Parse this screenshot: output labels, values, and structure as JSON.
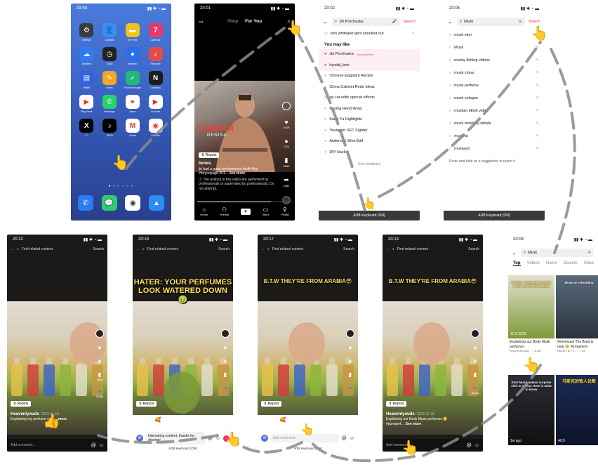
{
  "home": {
    "time": "19:58",
    "apps": [
      {
        "name": "Settings",
        "icon": "gear-icon",
        "color": "#3b3b3b",
        "glyph": "⚙"
      },
      {
        "name": "Contacts",
        "icon": "person-icon",
        "color": "#3a8ef2",
        "glyph": "👤"
      },
      {
        "name": "My Files",
        "icon": "folder-icon",
        "color": "#f2c318",
        "glyph": "▬"
      },
      {
        "name": "Calendar",
        "icon": "calendar-icon",
        "color": "#e83a6a",
        "glyph": "7"
      },
      {
        "name": "Weather",
        "icon": "weather-icon",
        "color": "#2e7cf0",
        "glyph": "☁"
      },
      {
        "name": "Clock",
        "icon": "clock-icon",
        "color": "#222222",
        "glyph": "◷"
      },
      {
        "name": "Browser",
        "icon": "browser-icon",
        "color": "#2b6fe8",
        "glyph": "●"
      },
      {
        "name": "Recorder",
        "icon": "mic-icon",
        "color": "#e84a4a",
        "glyph": "♪"
      },
      {
        "name": "Wallet",
        "icon": "wallet-icon",
        "color": "#3560e0",
        "glyph": "▤"
      },
      {
        "name": "Notes",
        "icon": "notes-icon",
        "color": "#f5a623",
        "glyph": "✎"
      },
      {
        "name": "Phone Manager",
        "icon": "shield-icon",
        "color": "#1fb97a",
        "glyph": "✓"
      },
      {
        "name": "Compass",
        "icon": "compass-icon",
        "color": "#1c1c1c",
        "glyph": "N"
      },
      {
        "name": "Play Store",
        "icon": "play-store-icon",
        "color": "#ffffff",
        "glyph": "▶"
      },
      {
        "name": "WhatsApp",
        "icon": "whatsapp-icon",
        "color": "#25d366",
        "glyph": "✆"
      },
      {
        "name": "Maps",
        "icon": "maps-icon",
        "color": "#ffffff",
        "glyph": "⌖"
      },
      {
        "name": "YouTube",
        "icon": "youtube-icon",
        "color": "#ffffff",
        "glyph": "▶"
      },
      {
        "name": "X",
        "icon": "x-icon",
        "color": "#000000",
        "glyph": "X"
      },
      {
        "name": "TikTok",
        "icon": "tiktok-icon",
        "color": "#000000",
        "glyph": "♪"
      },
      {
        "name": "Gmail",
        "icon": "gmail-icon",
        "color": "#ffffff",
        "glyph": "M"
      },
      {
        "name": "Chrome",
        "icon": "chrome-icon",
        "color": "#ffffff",
        "glyph": "◉"
      }
    ],
    "dock": [
      {
        "icon": "phone-icon",
        "color": "#2b7cf0",
        "glyph": "✆"
      },
      {
        "icon": "messages-icon",
        "color": "#2ecc71",
        "glyph": "💬"
      },
      {
        "icon": "camera-icon",
        "color": "#ffffff",
        "glyph": "◉"
      },
      {
        "icon": "gallery-icon",
        "color": "#2b8df0",
        "glyph": "▲"
      }
    ]
  },
  "video": {
    "time": "20:01",
    "tab_shop": "Shop",
    "tab_foryou": "For You",
    "overlay_text": "CHAZKA",
    "overlay_sub": "DENISA",
    "repost": "Repost",
    "user": "bxnes.",
    "caption": "jiri had a great performance #edit #fyp #foryoupage #UF...",
    "see_more": "See more",
    "warning": "The actions in this video are performed by professionals or supervised by professionals. Do not attempt.",
    "counts": [
      "674K",
      "3.5k",
      "6696",
      "2482"
    ],
    "nav": [
      "Home",
      "Friends",
      "",
      "Inbox",
      "Profile"
    ]
  },
  "suggest1": {
    "time": "20:02",
    "query": "Jiri Prochazka",
    "search": "Search",
    "history": "ben whittaker gets knocked out",
    "you_may_like": "You may like",
    "items": [
      {
        "text": "Jiri Prochazka",
        "tag": "Just watched",
        "hot": true
      },
      {
        "text": "kyndal_bret",
        "tag": "",
        "hot": true
      },
      {
        "text": "Chinese Eggplant Recipe",
        "tag": "",
        "hot": false
      },
      {
        "text": "China Cabinet Redo Ideas",
        "tag": "",
        "hot": false
      },
      {
        "text": "ap cut edits special effects",
        "tag": "",
        "hot": false
      },
      {
        "text": "Boxing Hand Wrap",
        "tag": "",
        "hot": false
      },
      {
        "text": "Kung Fu Highlights",
        "tag": "",
        "hot": false
      },
      {
        "text": "Youngest UFC Fighter",
        "tag": "",
        "hot": false
      },
      {
        "text": "Anderson Silva Edit",
        "tag": "",
        "hot": false
      },
      {
        "text": "DIY Hacks",
        "tag": "",
        "hot": false
      }
    ],
    "feedback": "Give feedback",
    "keyboard": "ADB Keyboard {ON}"
  },
  "suggest2": {
    "time": "20:05",
    "query": "Musk",
    "search": "Search",
    "items": [
      "musk elon",
      "Musk",
      "musky fishing videos",
      "musk china",
      "musk perfume",
      "musk cologne",
      "muskan tiktok video",
      "musk mood by lattafa",
      "muskrat",
      "muskaan"
    ],
    "hint": "Press and hold on a suggestion to report it",
    "keyboard": "ADB Keyboard {ON}"
  },
  "perfume": [
    {
      "time": "20:22",
      "overlay": "",
      "overlay_color": "#ffe25a",
      "placeholder": "Find related content",
      "search": "Search",
      "repost": "Repost",
      "user": "Heavenlyouds",
      "date": "2023-11-18",
      "caption": "Explaining my perfume rack...",
      "more": "more",
      "comment": "Add comment...",
      "counts": [
        "",
        "",
        "",
        "2898",
        "Share"
      ]
    },
    {
      "time": "20:19",
      "overlay": "HATER: YOUR PERFUMES LOOK WATERED DOWN 🤢",
      "overlay_color": "#ffe25a",
      "placeholder": "Find related content",
      "search": "Search",
      "repost": "Repost",
      "user": "",
      "date": "",
      "caption": "",
      "more": "",
      "comment": "Interesting content, thanks for sharing!",
      "emojis": [
        "😁",
        "🥰",
        "😂",
        "😳",
        "😏",
        "😅"
      ],
      "keyboard": "ADB Keyboard {ON}"
    },
    {
      "time": "20:17",
      "overlay": "B.T.W THEY'RE FROM ARABIA😎",
      "overlay_color": "#ffe25a",
      "placeholder": "Find related content",
      "search": "Search",
      "repost": "Repost",
      "user": "",
      "date": "",
      "caption": "",
      "more": "",
      "comment": "Add comment...",
      "emojis": [
        "😁",
        "🥰",
        "😂",
        "😳",
        "😏",
        "😅"
      ],
      "keyboard": "ADB Keyboard {ON}"
    },
    {
      "time": "20:13",
      "overlay": "B.T.W THEY'RE FROM ARABIA😎",
      "overlay_color": "#ffe25a",
      "placeholder": "Find related content",
      "search": "Search",
      "repost": "Repost",
      "user": "Heavenlyouds",
      "date": "2023-11-18",
      "caption": "Explaining our Body Musk perfumes 🙂 #pureperf...",
      "more": "See more",
      "comment": "Add comment...",
      "counts": [
        "",
        "",
        "",
        "",
        "Share"
      ]
    }
  ],
  "results": {
    "time": "20:08",
    "query": "Musk",
    "tabs": [
      "Top",
      "Videos",
      "Users",
      "Sounds",
      "Shop"
    ],
    "cells": [
      {
        "label": "HATER: YOUR PERFUMES LOOK WATERED DOWN",
        "date": "11-3-2023",
        "caption": "Explaining our Body Musk perfumes",
        "author": "heavenlyouds",
        "likes": "6.8K"
      },
      {
        "label": "Musk on rebuilding",
        "date": "",
        "caption": "#elonmusk The flood is near 🙂 Firmament",
        "author": "Money & Fi...",
        "likes": "23"
      },
      {
        "label": "Elon Musk makes surprise visit to China: Here is what to know",
        "date": "1w ago",
        "caption": "",
        "author": "",
        "likes": ""
      },
      {
        "label": "马斯克的惊人论断",
        "date": "4/19",
        "caption": "",
        "author": "",
        "likes": ""
      }
    ]
  }
}
